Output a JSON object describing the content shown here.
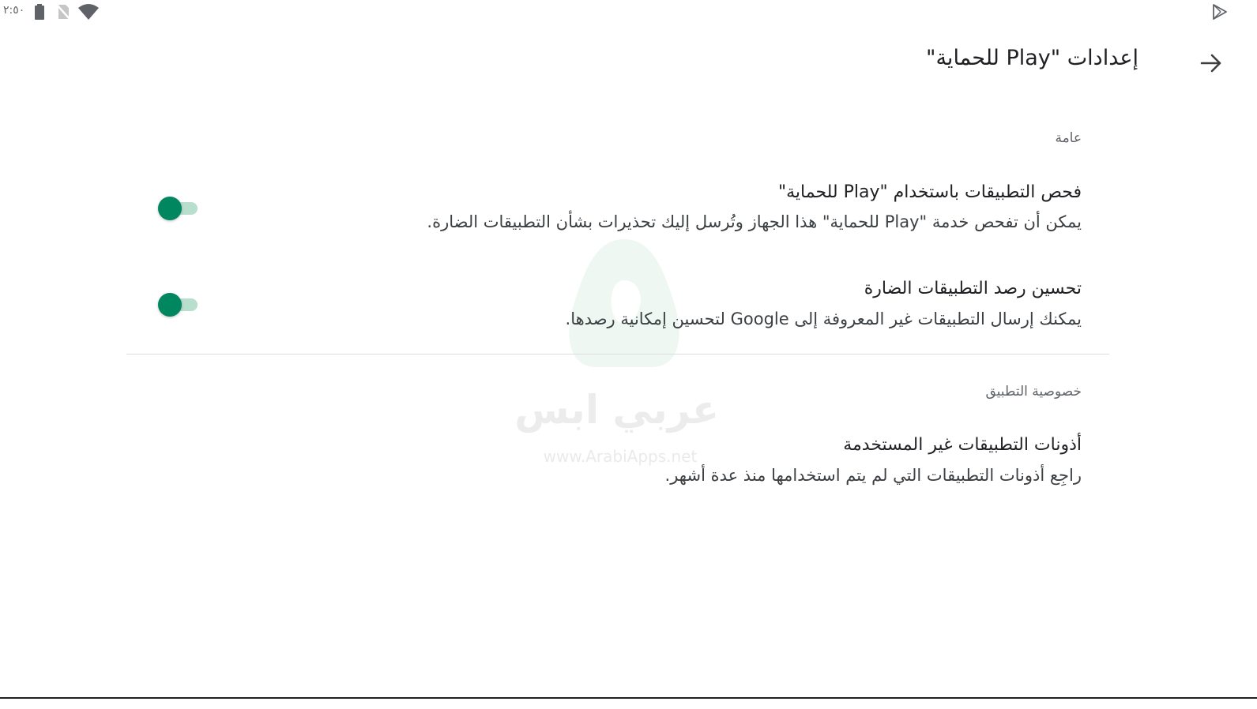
{
  "status_bar": {
    "time": "٢:٥٠",
    "icons": [
      "battery-icon",
      "no-sim-icon",
      "wifi-icon",
      "play-store-icon"
    ]
  },
  "header": {
    "title": "إعدادات \"Play للحماية\"",
    "back_icon": "arrow-icon"
  },
  "sections": [
    {
      "header": "عامة",
      "settings": [
        {
          "title": "فحص التطبيقات باستخدام \"Play للحماية\"",
          "description": "يمكن أن تفحص خدمة \"Play للحماية\" هذا الجهاز وتُرسل إليك تحذيرات بشأن التطبيقات الضارة.",
          "toggle_on": true
        },
        {
          "title": "تحسين رصد التطبيقات الضارة",
          "description": "يمكنك إرسال التطبيقات غير المعروفة إلى Google لتحسين إمكانية رصدها.",
          "toggle_on": true
        }
      ]
    },
    {
      "header": "خصوصية التطبيق",
      "settings": [
        {
          "title": "أذونات التطبيقات غير المستخدمة",
          "description": "راجِع أذونات التطبيقات التي لم يتم استخدامها منذ عدة أشهر."
        }
      ]
    }
  ],
  "watermark": {
    "text": "عربي ابس",
    "url": "www.ArabiApps.net"
  },
  "colors": {
    "toggle_thumb": "#01875f",
    "toggle_track": "#b8dece"
  }
}
